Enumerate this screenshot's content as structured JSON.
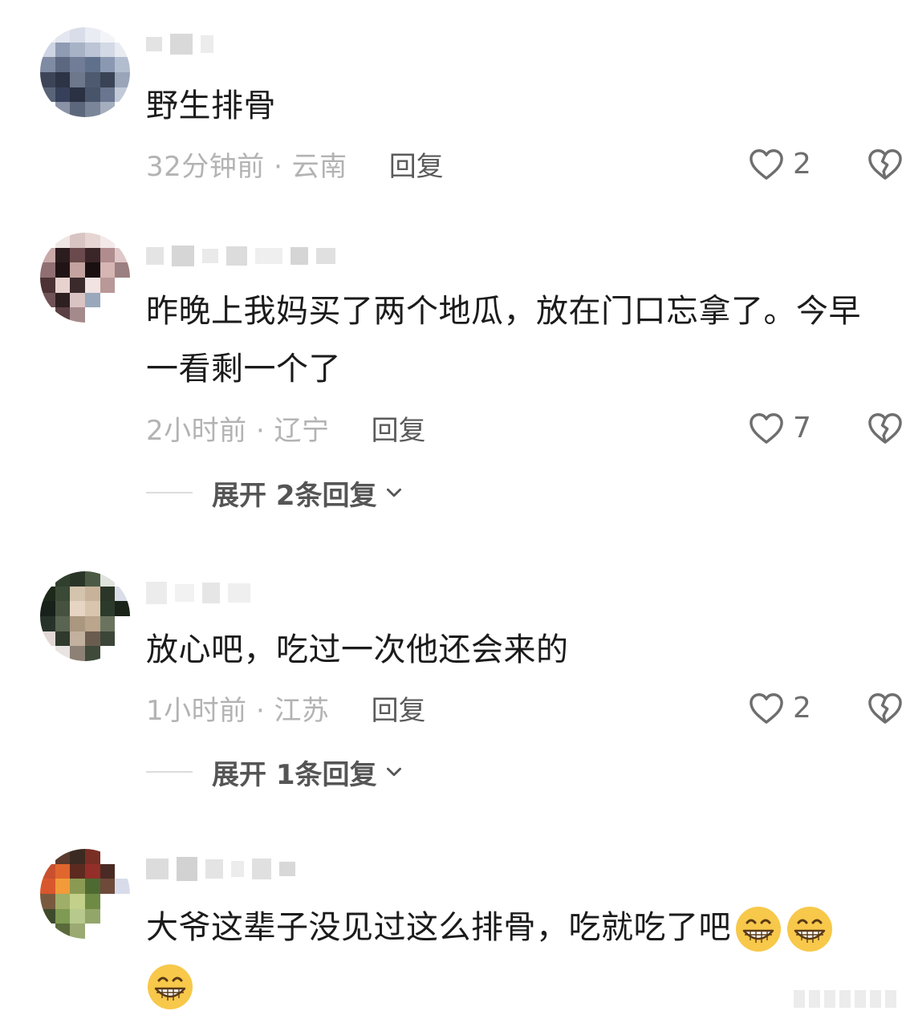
{
  "comments": [
    {
      "text": "野生排骨",
      "meta": "32分钟前 · 云南",
      "reply_label": "回复",
      "like_count": "2"
    },
    {
      "text": "昨晚上我妈买了两个地瓜，放在门口忘拿了。今早一看剩一个了",
      "meta": "2小时前 · 辽宁",
      "reply_label": "回复",
      "like_count": "7",
      "expand_label": "展开 2条回复"
    },
    {
      "text": "放心吧，吃过一次他还会来的",
      "meta": "1小时前 · 江苏",
      "reply_label": "回复",
      "like_count": "2",
      "expand_label": "展开 1条回复"
    },
    {
      "text": "大爷这辈子没见过这么排骨，吃就吃了吧",
      "emoji_icons": [
        "grin-emoji-icon",
        "grin-emoji-icon",
        "grin-emoji-icon"
      ]
    }
  ],
  "icons": {
    "like": "heart-outline-icon",
    "dislike": "broken-heart-icon",
    "expand": "chevron-down-icon"
  },
  "colors": {
    "text": "#1b1b1b",
    "meta": "#b3b3b3",
    "reply": "#5a5a5a",
    "icon": "#6e6e6e"
  }
}
